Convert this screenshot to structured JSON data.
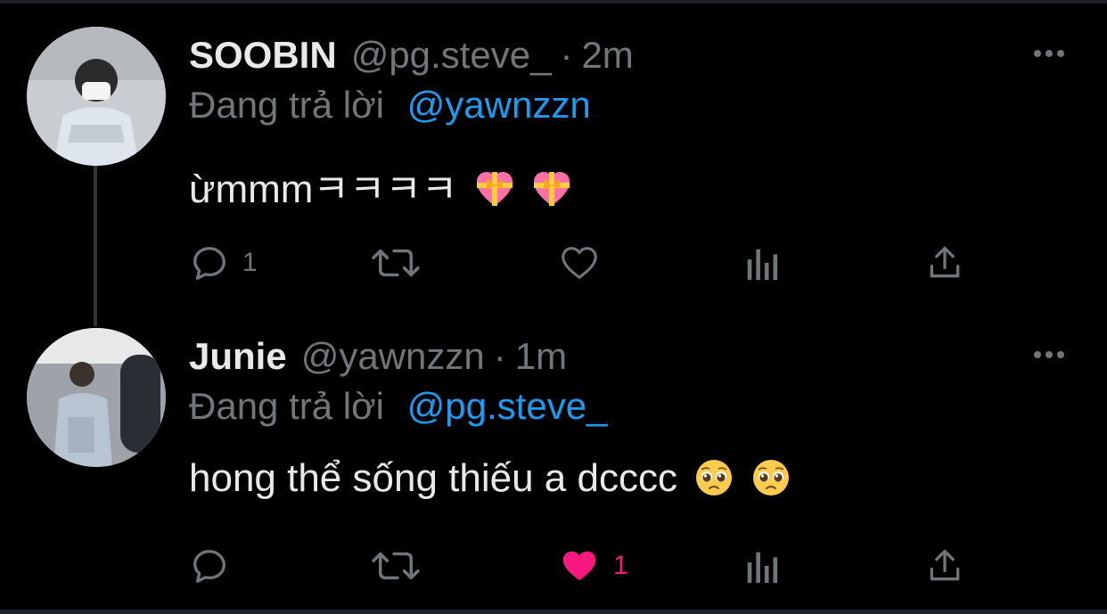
{
  "tweets": [
    {
      "name": "SOOBIN",
      "handle": "@pg.steve_",
      "separator": "·",
      "time": "2m",
      "reply_label": "Đang trả lời",
      "reply_to": "@yawnzzn",
      "text": "ừmmmㅋㅋㅋㅋ",
      "emojis": [
        "heart-with-ribbon-icon",
        "heart-with-ribbon-icon"
      ],
      "actions": {
        "reply_count": "1",
        "retweet_count": "",
        "like_count": "",
        "liked": false
      }
    },
    {
      "name": "Junie",
      "handle": "@yawnzzn",
      "separator": "·",
      "time": "1m",
      "reply_label": "Đang trả lời",
      "reply_to": "@pg.steve_",
      "text": "hong thể sống thiếu a dcccc",
      "emojis": [
        "pleading-face-icon",
        "pleading-face-icon"
      ],
      "actions": {
        "reply_count": "",
        "retweet_count": "",
        "like_count": "1",
        "liked": true
      }
    }
  ],
  "colors": {
    "background": "#000000",
    "text": "#e7e9ea",
    "muted": "#71767b",
    "mention": "#1d9bf0",
    "like": "#f91880"
  }
}
